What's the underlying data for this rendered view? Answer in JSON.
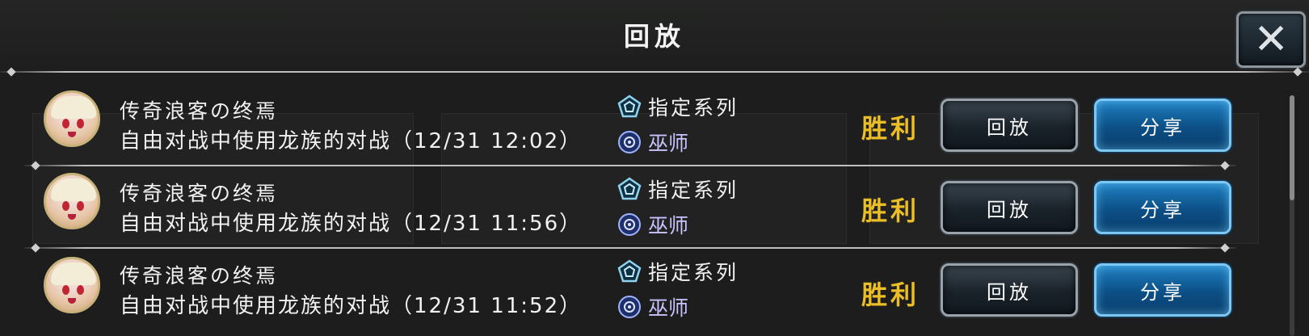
{
  "header": {
    "title": "回放",
    "close_icon": "close-icon"
  },
  "colors": {
    "result_win": "#ebbe28",
    "class_text": "#c9c3ff",
    "share_button": "#1f7fc0",
    "replay_button": "#1a2229"
  },
  "records": [
    {
      "player_name": "传奇浪客の终焉",
      "description": "自由对战中使用龙族的对战（12/31 12:02）",
      "deck_type": "指定系列",
      "opponent_class": "巫师",
      "result": "胜利",
      "replay_label": "回放",
      "share_label": "分享"
    },
    {
      "player_name": "传奇浪客の终焉",
      "description": "自由对战中使用龙族的对战（12/31 11:56）",
      "deck_type": "指定系列",
      "opponent_class": "巫师",
      "result": "胜利",
      "replay_label": "回放",
      "share_label": "分享"
    },
    {
      "player_name": "传奇浪客の终焉",
      "description": "自由对战中使用龙族的对战（12/31 11:52）",
      "deck_type": "指定系列",
      "opponent_class": "巫师",
      "result": "胜利",
      "replay_label": "回放",
      "share_label": "分享"
    }
  ]
}
